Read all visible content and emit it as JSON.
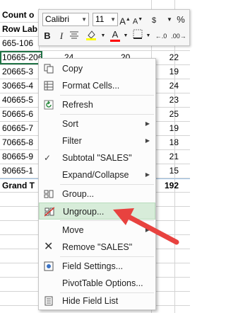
{
  "sheet": {
    "header1": "Count o",
    "header2": "Row Lab",
    "rows": [
      {
        "label": "665-106",
        "b": "",
        "c": "",
        "d": "",
        "e": ""
      },
      {
        "label": "10665-20664",
        "b": "24",
        "c": "20",
        "d": "",
        "e": "22"
      },
      {
        "label": "20665-3",
        "b": "",
        "c": "",
        "d": "",
        "e": "19"
      },
      {
        "label": "30665-4",
        "b": "",
        "c": "",
        "d": "",
        "e": "24"
      },
      {
        "label": "40665-5",
        "b": "",
        "c": "",
        "d": "",
        "e": "23"
      },
      {
        "label": "50665-6",
        "b": "",
        "c": "",
        "d": "",
        "e": "25"
      },
      {
        "label": "60665-7",
        "b": "",
        "c": "",
        "d": "",
        "e": "19"
      },
      {
        "label": "70665-8",
        "b": "",
        "c": "",
        "d": "",
        "e": "18"
      },
      {
        "label": "80665-9",
        "b": "",
        "c": "",
        "d": "",
        "e": "21"
      },
      {
        "label": "90665-1",
        "b": "",
        "c": "",
        "d": "",
        "e": "15"
      }
    ],
    "grand_label": "Grand T",
    "grand_value": "192"
  },
  "toolbar": {
    "font_name": "Calibri",
    "font_size": "11",
    "grow": "A",
    "shrink": "A",
    "currency": "$",
    "percent": "%",
    "bold": "B",
    "italic": "I",
    "font_color": "A",
    "colors": {
      "highlight": "#ffff00",
      "font": "#ff0000"
    }
  },
  "menu": {
    "items": [
      {
        "label": "Copy",
        "icon": "copy-icon"
      },
      {
        "label": "Format Cells...",
        "icon": "format-cells-icon"
      },
      {
        "label": "Refresh",
        "icon": "refresh-icon"
      },
      {
        "label": "Sort",
        "icon": ""
      },
      {
        "label": "Filter",
        "icon": ""
      },
      {
        "label": "Subtotal \"SALES\"",
        "icon": "checkmark-icon"
      },
      {
        "label": "Expand/Collapse",
        "icon": ""
      },
      {
        "label": "Group...",
        "icon": "group-icon"
      },
      {
        "label": "Ungroup...",
        "icon": "ungroup-icon"
      },
      {
        "label": "Move",
        "icon": ""
      },
      {
        "label": "Remove \"SALES\"",
        "icon": "remove-x-icon"
      },
      {
        "label": "Field Settings...",
        "icon": "field-settings-icon"
      },
      {
        "label": "PivotTable Options...",
        "icon": ""
      },
      {
        "label": "Hide Field List",
        "icon": "field-list-icon"
      }
    ]
  },
  "annotation": {
    "color": "#e8423f"
  }
}
